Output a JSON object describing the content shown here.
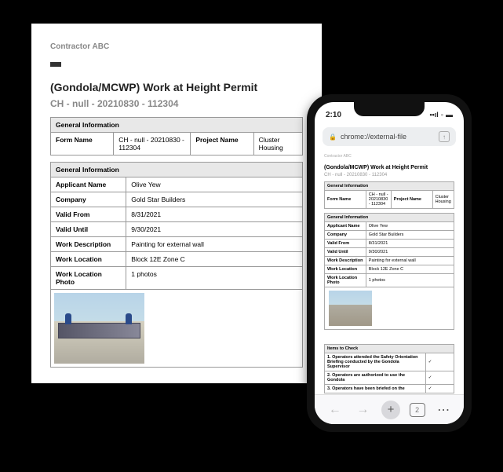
{
  "document": {
    "contractor": "Contractor ABC",
    "title": "(Gondola/MCWP) Work at Height Permit",
    "subtitle": "CH - null - 20210830 - 112304",
    "section1_header": "General Information",
    "formNameLabel": "Form Name",
    "formNameValue": "CH - null - 20210830 - 112304",
    "projectNameLabel": "Project Name",
    "projectNameValue": "Cluster Housing",
    "section2_header": "General Information",
    "rows": [
      {
        "label": "Applicant Name",
        "value": "Olive Yew"
      },
      {
        "label": "Company",
        "value": "Gold Star Builders"
      },
      {
        "label": "Valid From",
        "value": "8/31/2021"
      },
      {
        "label": "Valid Until",
        "value": "9/30/2021"
      },
      {
        "label": "Work Description",
        "value": "Painting for external wall"
      },
      {
        "label": "Work Location",
        "value": "Block 12E Zone C"
      },
      {
        "label": "Work Location Photo",
        "value": "1 photos"
      }
    ]
  },
  "phone": {
    "time": "2:10",
    "url": "chrome://external-file",
    "check_header": "Items to Check",
    "checks": [
      {
        "text": "1. Operators attended the Safety Orientation Briefing conducted by the Gondola Supervisor",
        "val": "✓"
      },
      {
        "text": "2. Operators are authorized to use the Gondola",
        "val": "✓"
      },
      {
        "text": "3. Operators have been briefed on the",
        "val": "✓"
      }
    ],
    "tab_count": "2"
  }
}
